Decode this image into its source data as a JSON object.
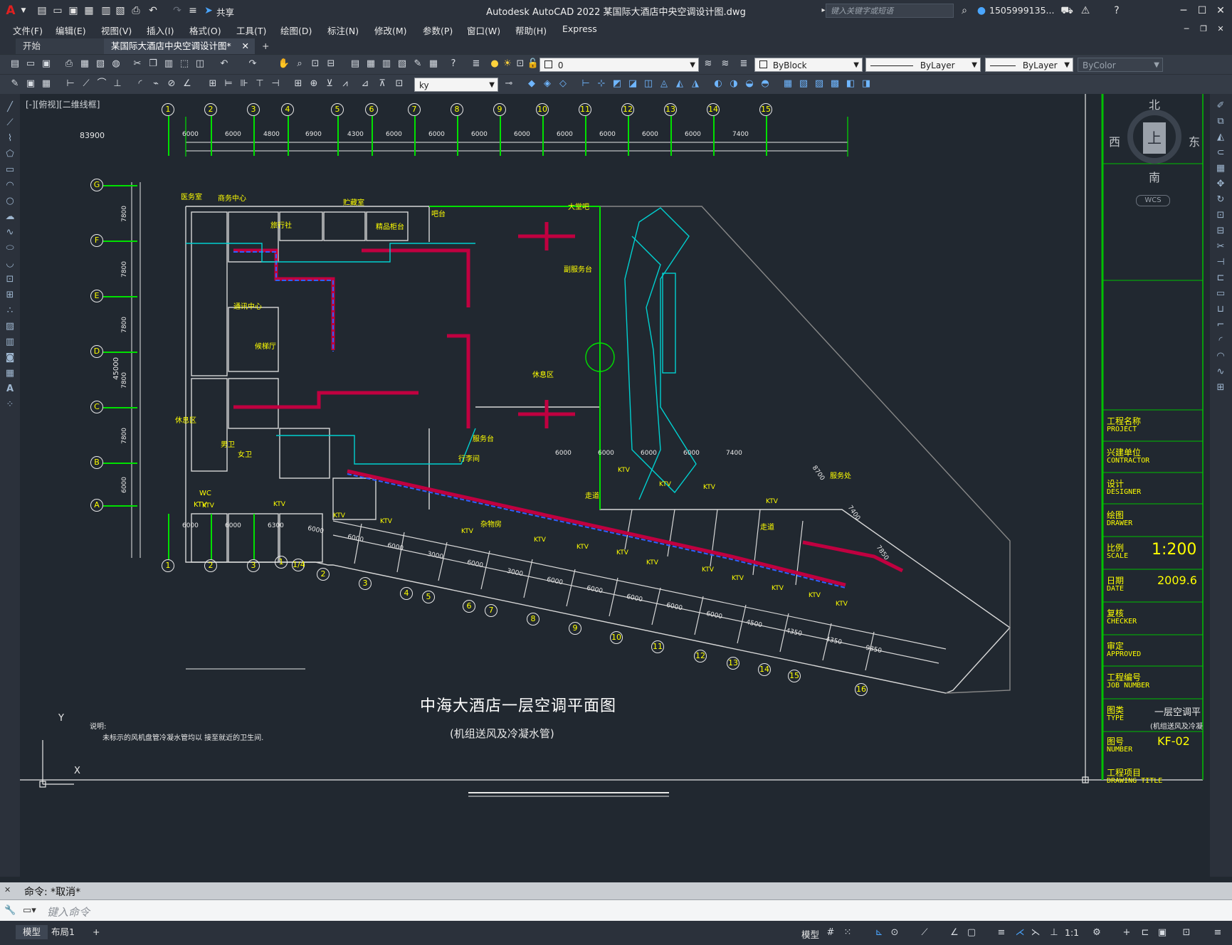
{
  "app": {
    "title": "Autodesk AutoCAD 2022    某国际大酒店中央空调设计图.dwg",
    "share_label": "共享",
    "search_placeholder": "键入关键字或短语",
    "user": "1505999135...",
    "accent_color": "#e02020"
  },
  "menu": [
    "文件(F)",
    "编辑(E)",
    "视图(V)",
    "插入(I)",
    "格式(O)",
    "工具(T)",
    "绘图(D)",
    "标注(N)",
    "修改(M)",
    "参数(P)",
    "窗口(W)",
    "帮助(H)",
    "Express"
  ],
  "tabs": {
    "start": "开始",
    "drawing": "某国际大酒店中央空调设计图*",
    "close_glyph": "✕",
    "new_glyph": "+"
  },
  "toolbar": {
    "layer_value": "0",
    "color_value": "ByBlock",
    "linetype_value": "ByLayer",
    "lineweight_value": "ByLayer",
    "plotstyle_value": "ByColor",
    "dimstyle_value": "ky"
  },
  "viewport": {
    "label": "[-][俯视][二维线框]",
    "viewcube": {
      "north": "北",
      "south": "南",
      "east": "东",
      "west": "西",
      "top": "上",
      "wcs": "WCS"
    },
    "ucs_x": "X",
    "ucs_y": "Y"
  },
  "drawing": {
    "title": "中海大酒店一层空调平面图",
    "subtitle": "(机组送风及冷凝水管)",
    "note_label": "说明:",
    "note_text": "未标示的风机盘管冷凝水管均以  接至就近的卫生间.",
    "grid_top": [
      "1",
      "2",
      "3",
      "4",
      "5",
      "6",
      "7",
      "8",
      "9",
      "10",
      "11",
      "12",
      "13",
      "14",
      "15"
    ],
    "grid_left": [
      "G",
      "F",
      "E",
      "D",
      "C",
      "B",
      "A"
    ],
    "grid_bottom_straight": [
      "1",
      "2",
      "3"
    ],
    "grid_bottom_angled": [
      "1",
      "1/4",
      "2",
      "3",
      "4",
      "5",
      "6",
      "7",
      "8",
      "9",
      "10",
      "11",
      "12",
      "13",
      "14",
      "15",
      "16"
    ],
    "top_dims": [
      "6000",
      "6000",
      "4800",
      "6900",
      "4300",
      "6000",
      "6000",
      "6000",
      "6000",
      "6000",
      "6000",
      "6000",
      "6000",
      "7400"
    ],
    "top_total": "83900",
    "left_dims": [
      "7800",
      "7800",
      "7800",
      "7800",
      "7800",
      "6000"
    ],
    "left_total": "45000",
    "bottom_dims": [
      "6000",
      "6000",
      "6300"
    ],
    "right_dims": [
      "6000",
      "6000",
      "6000",
      "6000",
      "7400"
    ],
    "angled_dims": [
      "6000",
      "6000",
      "6000",
      "3000",
      "6000",
      "3000",
      "6000",
      "6000",
      "6000",
      "6000",
      "6000",
      "4500",
      "4350",
      "4350",
      "9850"
    ],
    "diag_dims": [
      "8700",
      "7400",
      "7850"
    ],
    "rooms": [
      "医务室",
      "商务中心",
      "贮藏室",
      "吧台",
      "大堂吧",
      "旅行社",
      "精品柜台",
      "副服务台",
      "通讯中心",
      "候梯厅",
      "休息区",
      "休息区",
      "服务台",
      "行李间",
      "男卫",
      "女卫",
      "服务处",
      "走道",
      "杂物房",
      "走道",
      "KTV",
      "WC"
    ]
  },
  "title_block": {
    "rows": [
      {
        "cn": "工程名称",
        "en": "PROJECT",
        "value": ""
      },
      {
        "cn": "兴建单位",
        "en": "CONTRACTOR",
        "value": ""
      },
      {
        "cn": "设计",
        "en": "DESIGNER",
        "value": ""
      },
      {
        "cn": "绘图",
        "en": "DRAWER",
        "value": ""
      },
      {
        "cn": "比例",
        "en": "SCALE",
        "value": "1:200"
      },
      {
        "cn": "日期",
        "en": "DATE",
        "value": "2009.6"
      },
      {
        "cn": "复核",
        "en": "CHECKER",
        "value": ""
      },
      {
        "cn": "审定",
        "en": "APPROVED",
        "value": ""
      },
      {
        "cn": "工程编号",
        "en": "JOB NUMBER",
        "value": ""
      },
      {
        "cn": "图类",
        "en": "TYPE",
        "value": "一层空调平"
      },
      {
        "cn": "图号",
        "en": "NUMBER",
        "value": "KF-02"
      },
      {
        "cn": "工程项目",
        "en": "DRAWING TITLE",
        "value": ""
      }
    ],
    "type_sub": "(机组送风及冷凝"
  },
  "command": {
    "history": "命令:  *取消*",
    "placeholder": "键入命令"
  },
  "status": {
    "model_tab": "模型",
    "layout_tab": "布局1",
    "add": "+",
    "model_space": "模型",
    "scale": "1:1"
  }
}
